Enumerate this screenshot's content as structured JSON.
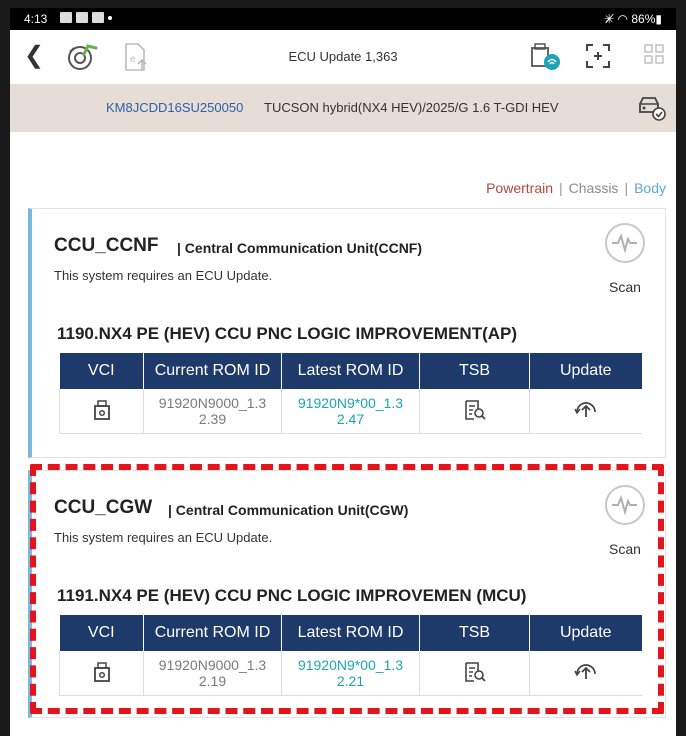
{
  "status_bar": {
    "time": "4:13",
    "right": "✳̸ ◠ 86%▮"
  },
  "app_bar": {
    "back_icon": "chevron-left-icon",
    "title": "ECU Update 1,363"
  },
  "vehicle": {
    "vin": "KM8JCDD16SU250050",
    "model": "TUCSON hybrid(NX4 HEV)/2025/G 1.6 T-GDI HEV"
  },
  "categories": {
    "powertrain": "Powertrain",
    "chassis": "Chassis",
    "body": "Body",
    "separator": "|"
  },
  "table_headers": [
    "VCI",
    "Current ROM ID",
    "Latest ROM ID",
    "TSB",
    "Update"
  ],
  "ecus": [
    {
      "code": "CCU_CCNF",
      "description": "| Central Communication Unit(CCNF)",
      "message": "This system requires an ECU Update.",
      "scan_label": "Scan",
      "update_title": "1190.NX4 PE (HEV) CCU PNC LOGIC IMPROVEMENT(AP)",
      "current_rom_line1": "91920N9000_1.3",
      "current_rom_line2": "2.39",
      "latest_rom_line1": "91920N9*00_1.3",
      "latest_rom_line2": "2.47"
    },
    {
      "code": "CCU_CGW",
      "description": "| Central Communication Unit(CGW)",
      "message": "This system requires an ECU Update.",
      "scan_label": "Scan",
      "update_title": "1191.NX4 PE (HEV) CCU PNC LOGIC IMPROVEMEN (MCU)",
      "current_rom_line1": "91920N9000_1.3",
      "current_rom_line2": "2.19",
      "latest_rom_line1": "91920N9*00_1.3",
      "latest_rom_line2": "2.21"
    }
  ],
  "colors": {
    "header_navy": "#1d3a6a",
    "latest_rom_teal": "#1ca4b5",
    "highlight_red": "#e3141c",
    "powertrain": "#b5483e",
    "body": "#5fa7cf"
  }
}
